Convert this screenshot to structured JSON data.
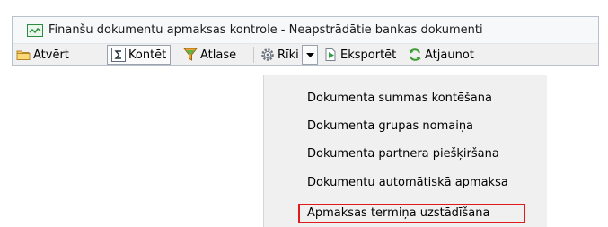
{
  "window": {
    "title": "Finanšu dokumentu apmaksas kontrole - Neapstrādātie bankas dokumenti"
  },
  "toolbar": {
    "open_label": "Atvērt",
    "post_label": "Kontēt",
    "filter_label": "Atlase",
    "tools_label": "Rīki",
    "export_label": "Eksportēt",
    "refresh_label": "Atjaunot"
  },
  "menu": {
    "items": [
      {
        "label": "Dokumenta summas kontēšana"
      },
      {
        "label": "Dokumenta grupas nomaiņa"
      },
      {
        "label": "Dokumenta partnera piešķiršana"
      },
      {
        "label": "Dokumentu automātiskā apmaksa"
      },
      {
        "label": "Apmaksas termiņa uzstādīšana",
        "highlighted": true
      }
    ]
  },
  "icons": {
    "title": "chart-window-icon",
    "open": "folder-icon",
    "post": "sigma-icon",
    "filter": "funnel-icon",
    "tools": "gear-icon",
    "dropdown": "chevron-down-icon",
    "export": "export-icon",
    "refresh": "refresh-icon"
  },
  "colors": {
    "highlight_border": "#e01b1b",
    "menu_background": "#f0f0f0",
    "window_border": "#b9c1cc"
  }
}
